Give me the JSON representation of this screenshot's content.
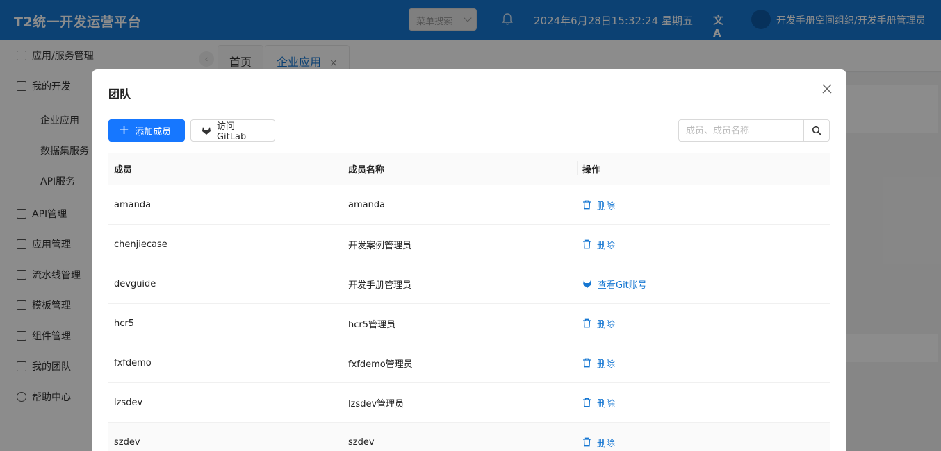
{
  "header": {
    "app_title": "T2统一开发运营平台",
    "menu_search_placeholder": "菜单搜索",
    "datetime": "2024年6月28日15:32:24 星期五",
    "translate_label": "文A",
    "user_org": "开发手册空间组织/开发手册管理员",
    "colors": {
      "header_bg": "#1677d2",
      "primary": "#1677ff"
    }
  },
  "sidebar": {
    "items": [
      {
        "label": "应用/服务管理",
        "icon": "app-grid-icon"
      },
      {
        "label": "我的开发",
        "icon": "code-box-icon"
      },
      {
        "label": "API管理",
        "icon": "link-icon"
      },
      {
        "label": "应用管理",
        "icon": "grid-icon"
      },
      {
        "label": "流水线管理",
        "icon": "pipeline-icon"
      },
      {
        "label": "模板管理",
        "icon": "template-icon"
      },
      {
        "label": "组件管理",
        "icon": "component-icon"
      },
      {
        "label": "我的团队",
        "icon": "team-icon"
      },
      {
        "label": "帮助中心",
        "icon": "help-icon"
      }
    ],
    "sub_items": [
      "企业应用",
      "数据集服务",
      "API服务"
    ]
  },
  "tabs": [
    {
      "label": "首页"
    },
    {
      "label": "企业应用",
      "close": "×"
    }
  ],
  "modal": {
    "title": "团队",
    "add_member_label": "添加成员",
    "visit_gitlab_label": "访问GitLab",
    "search_placeholder": "成员、成员名称",
    "columns": [
      "成员",
      "成员名称",
      "操作"
    ],
    "rows": [
      {
        "member": "amanda",
        "name": "amanda",
        "action": "删除",
        "action_icon": "trash-icon"
      },
      {
        "member": "chenjiecase",
        "name": "开发案例管理员",
        "action": "删除",
        "action_icon": "trash-icon"
      },
      {
        "member": "devguide",
        "name": "开发手册管理员",
        "action": "查看Git账号",
        "action_icon": "gitlab-icon"
      },
      {
        "member": "hcr5",
        "name": "hcr5管理员",
        "action": "删除",
        "action_icon": "trash-icon"
      },
      {
        "member": "fxfdemo",
        "name": "fxfdemo管理员",
        "action": "删除",
        "action_icon": "trash-icon"
      },
      {
        "member": "lzsdev",
        "name": "lzsdev管理员",
        "action": "删除",
        "action_icon": "trash-icon"
      },
      {
        "member": "szdev",
        "name": "szdev",
        "action": "删除",
        "action_icon": "trash-icon"
      }
    ]
  }
}
